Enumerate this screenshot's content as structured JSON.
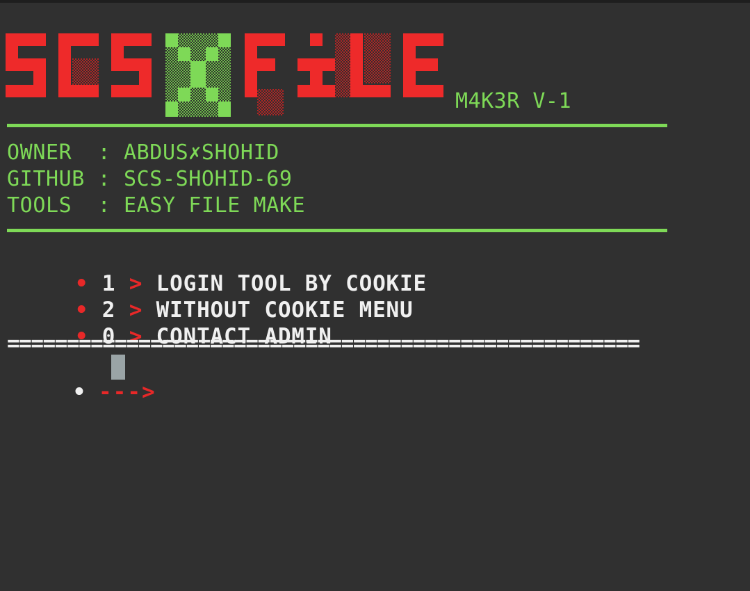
{
  "banner": {
    "logo_text": "SCS✗FILE",
    "version": "M4K3R V-1"
  },
  "info": {
    "owner_line": "OWNER  : ABDUS✗SHOHID",
    "github_line": "GITHUB : SCS-SHOHID-69",
    "tools_line": "TOOLS  : EASY FILE MAKE"
  },
  "menu": {
    "items": [
      {
        "bullet": "•",
        "key": "1",
        "arrow": ">",
        "label": "LOGIN TOOL BY COOKIE"
      },
      {
        "bullet": "•",
        "key": "2",
        "arrow": ">",
        "label": "WITHOUT COOKIE MENU"
      },
      {
        "bullet": "•",
        "key": "0",
        "arrow": ">",
        "label": "CONTACT ADMIN"
      }
    ]
  },
  "separator": "=====================================================",
  "prompt": {
    "bullet": "•",
    "arrow": "--->"
  },
  "colors": {
    "background": "#303030",
    "green": "#7ed957",
    "red": "#e82828",
    "white": "#f0f0f0",
    "cursor": "#9aa4a6"
  }
}
